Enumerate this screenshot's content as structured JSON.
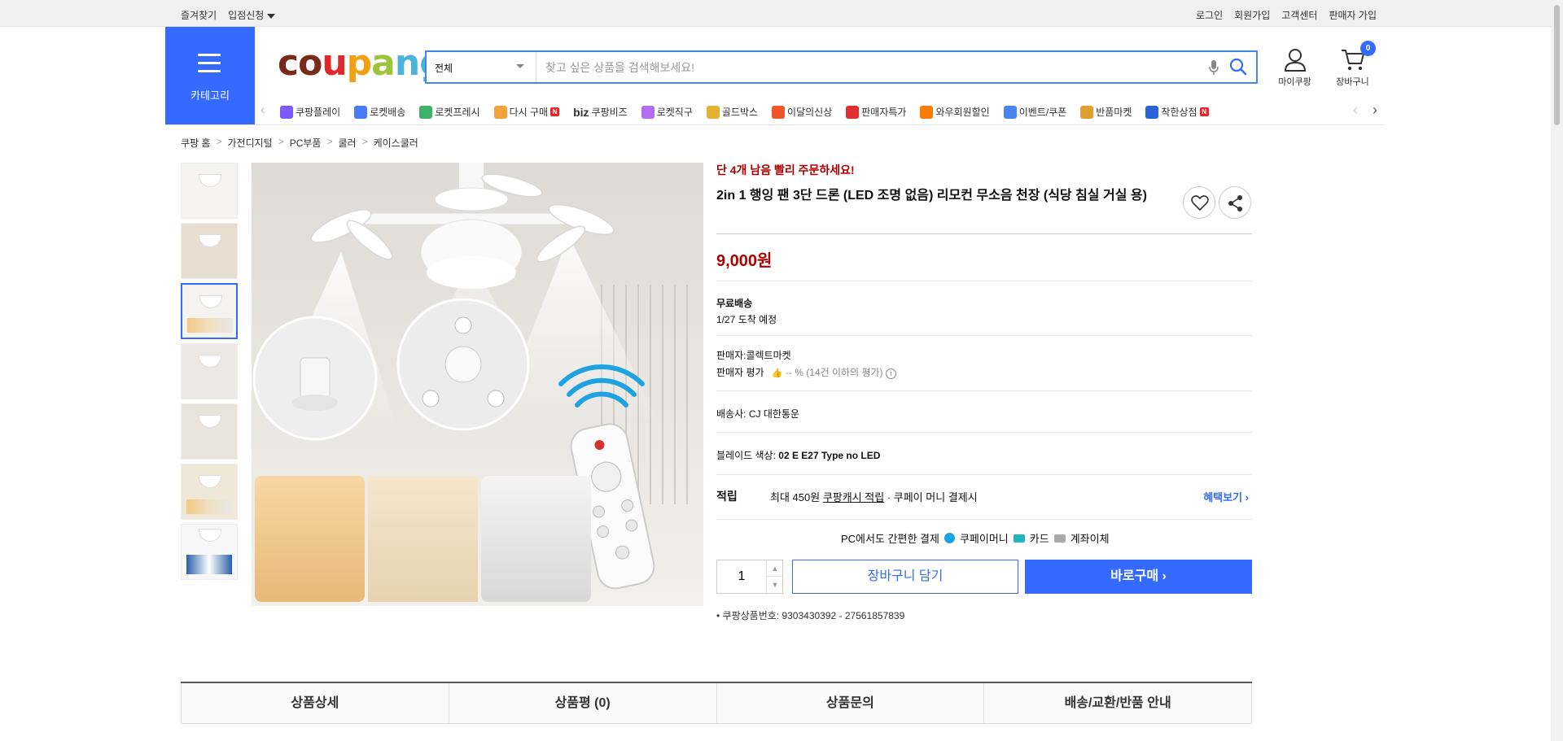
{
  "topbar": {
    "favorites": "즐겨찾기",
    "vendor_apply": "입점신청",
    "login": "로그인",
    "signup": "회원가입",
    "customer_center": "고객센터",
    "seller_signup": "판매자 가입"
  },
  "header": {
    "category_label": "카테고리",
    "logo": "coupang",
    "search_category": "전체",
    "search_placeholder": "찾고 싶은 상품을 검색해보세요!",
    "mycoupang": "마이쿠팡",
    "cart": "장바구니",
    "cart_count": "0"
  },
  "catnav": {
    "items": [
      {
        "label": "쿠팡플레이",
        "icon": "play-icon",
        "color": "#7b5cff"
      },
      {
        "label": "로켓배송",
        "icon": "rocket-icon",
        "color": "#4a7bf7"
      },
      {
        "label": "로켓프레시",
        "icon": "rocket-fresh-icon",
        "color": "#3db36a"
      },
      {
        "label": "다시 구매",
        "icon": "rebuy-icon",
        "color": "#f2a23a",
        "badge": "N"
      },
      {
        "label": "쿠팡비즈",
        "prefix": "biz",
        "icon": "biz-icon",
        "color": "#333333"
      },
      {
        "label": "로켓직구",
        "icon": "global-icon",
        "color": "#b56cf0"
      },
      {
        "label": "골드박스",
        "icon": "goldbox-icon",
        "color": "#e3b233"
      },
      {
        "label": "이달의신상",
        "icon": "new-icon",
        "color": "#f0562a"
      },
      {
        "label": "판매자특가",
        "icon": "percent-icon",
        "color": "#e03030"
      },
      {
        "label": "와우회원할인",
        "icon": "wow-icon",
        "color": "#ff7a00"
      },
      {
        "label": "이벤트/쿠폰",
        "icon": "coupon-icon",
        "color": "#4b84f0"
      },
      {
        "label": "반품마켓",
        "icon": "market-icon",
        "color": "#e0a030"
      },
      {
        "label": "착한상점",
        "icon": "store-icon",
        "color": "#2a62d8",
        "badge": "N"
      }
    ]
  },
  "breadcrumb": [
    "쿠팡 홈",
    "가전디지털",
    "PC부품",
    "쿨러",
    "케이스쿨러"
  ],
  "product": {
    "urgent": "단 4개 남음 빨리 주문하세요!",
    "title": "2in 1 행잉 팬 3단 드론 (LED 조명 없음) 리모컨 무소음 천장 (식당 침실 거실 용)",
    "price": "9,000원",
    "shipping_label": "무료배송",
    "arrival": "1/27 도착 예정",
    "seller_label": "판매자:",
    "seller_name": "콜렉트마켓",
    "rating_label": "판매자 평가",
    "rating_value": "-- %",
    "rating_note": "(14건 이하의 평가)",
    "courier_label": "배송사:",
    "courier_name": "CJ 대한통운",
    "option_label": "블레이드 색상:",
    "option_value": "02 E E27 Type no LED",
    "reward_label": "적립",
    "reward_max": "최대 450원",
    "reward_link": "쿠팡캐시 적립",
    "reward_suffix": "· 쿠페이 머니 결제시",
    "benefit_link": "혜택보기",
    "pay_title": "PC에서도 간편한 결제",
    "pay_methods": [
      "쿠페이머니",
      "카드",
      "계좌이체"
    ],
    "quantity": "1",
    "add_cart": "장바구니 담기",
    "buy_now": "바로구매",
    "product_no": "쿠팡상품번호: 9303430392 - 27561857839"
  },
  "tabs": [
    "상품상세",
    "상품평 (0)",
    "상품문의",
    "배송/교환/반품 안내"
  ],
  "colors": {
    "accent": "#346aff",
    "price_red": "#ae0000"
  }
}
